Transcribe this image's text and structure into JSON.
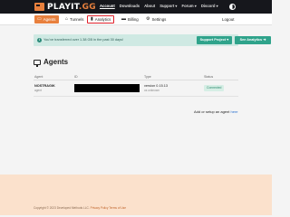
{
  "app": {
    "logo_text": "PLAYIT",
    "logo_tld": ".GG"
  },
  "topnav": {
    "items": [
      "Account",
      "Downloads",
      "About",
      "Support ▾",
      "Forum ▾",
      "Discord ▾"
    ]
  },
  "subnav": {
    "agents": "Agents",
    "tunnels": "Tunnels",
    "analytics": "Analytics",
    "billing": "Billing",
    "settings": "Settings",
    "logout": "Logout"
  },
  "banner": {
    "message": "You've transferred over 1.38 GB in the past 30 days!",
    "support_button": "Support Project ♥",
    "analytics_button": "See Analytics ➜"
  },
  "page": {
    "title": "Agents"
  },
  "table": {
    "headers": [
      "Agent",
      "ID",
      "Type",
      "Status"
    ],
    "rows": [
      {
        "name": "NOSTRAGIK",
        "type": "agent",
        "version": "version 0.15.13",
        "sub": "os unknown",
        "status": "Connected"
      }
    ]
  },
  "setup": {
    "prefix": "Add or setup an agent",
    "link": "here"
  },
  "footer": {
    "copyright": "Copyright © 2023 Developed Methods LLC.",
    "link": "Privacy Policy  Terms of Use"
  },
  "colors": {
    "accent": "#e8803d",
    "topbar": "#16171c",
    "banner": "#cfe9e3",
    "footer": "#fbe1cc",
    "green_button": "#2fa38b"
  }
}
